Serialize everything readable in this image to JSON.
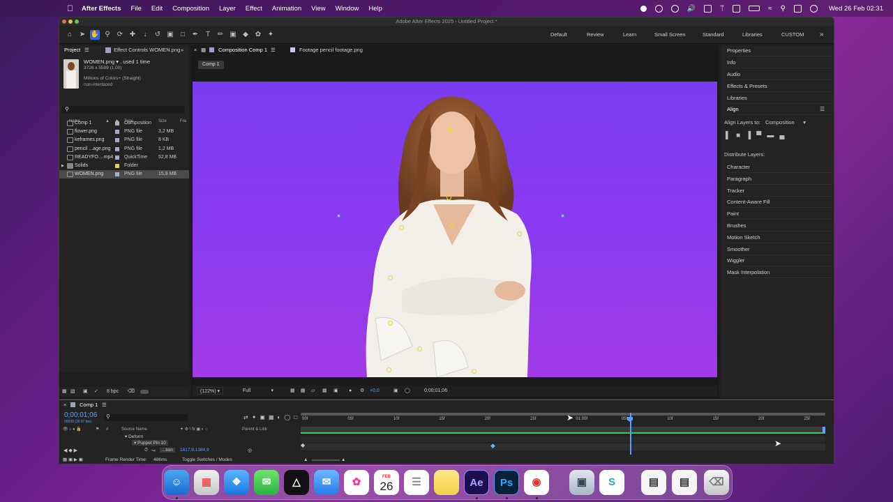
{
  "menubar": {
    "app": "After Effects",
    "items": [
      "File",
      "Edit",
      "Composition",
      "Layer",
      "Effect",
      "Animation",
      "View",
      "Window",
      "Help"
    ],
    "clock": "Wed 26 Feb  02:31"
  },
  "window": {
    "title": "Adobe After Effects 2025 - Untitled Project *"
  },
  "workspaces": [
    "Default",
    "Review",
    "Learn",
    "Small Screen",
    "Standard",
    "Libraries",
    "CUSTOM"
  ],
  "project": {
    "tabs": [
      "Project",
      "Effect Controls WOMEN.png"
    ],
    "preview": {
      "name": "WOMEN.png ▾ , used 1 time",
      "dims": "3726 x 5589 (1,00)",
      "colors": "Millions of Colors+ (Straight)",
      "interlace": "non-interlaced"
    },
    "columns": [
      "Name",
      "Type",
      "Size",
      "Fra"
    ],
    "rows": [
      {
        "name": "Comp 1",
        "type": "Composition",
        "size": "",
        "label": "#b0b0b0"
      },
      {
        "name": "flower.png",
        "type": "PNG file",
        "size": "3,2 MB",
        "label": "#a9a9c8"
      },
      {
        "name": "keframes.png",
        "type": "PNG file",
        "size": "8 KB",
        "label": "#a9a9c8"
      },
      {
        "name": "pencil ...age.png",
        "type": "PNG file",
        "size": "1,2 MB",
        "label": "#a9a9c8"
      },
      {
        "name": "READYFO....mp4",
        "type": "QuickTime",
        "size": "52,8 MB",
        "label": "#a9a9c8"
      },
      {
        "name": "Solids",
        "type": "Folder",
        "size": "",
        "label": "#e0d050"
      },
      {
        "name": "WOMEN.png",
        "type": "PNG file",
        "size": "15,9 MB",
        "label": "#a9a9c8"
      }
    ],
    "bpc": "8 bpc"
  },
  "viewer": {
    "tabs": [
      "Composition Comp 1",
      "Footage pencil footage.png"
    ],
    "comp_chip": "Comp 1",
    "zoom": "(122%)",
    "quality": "Full",
    "exposure": "+0,0",
    "timecode": "0;00;01;06"
  },
  "right_panel": {
    "items_top": [
      "Properties",
      "Info",
      "Audio",
      "Effects & Presets",
      "Libraries"
    ],
    "align_title": "Align",
    "align_to_label": "Align Layers to:",
    "align_to_value": "Composition",
    "distribute": "Distribute Layers:",
    "items_bottom": [
      "Character",
      "Paragraph",
      "Tracker",
      "Content-Aware Fill",
      "Paint",
      "Brushes",
      "Motion Sketch",
      "Smoother",
      "Wiggler",
      "Mask Interpolation"
    ]
  },
  "timeline": {
    "tab": "Comp 1",
    "timecode": "0;00;01;06",
    "subcode": "00030 (29.97 fps)",
    "col_source": "Source Name",
    "col_parent": "Parent & Link",
    "ruler": [
      "00f",
      "05f",
      "10f",
      "15f",
      "20f",
      "25f",
      "01:00f",
      "05f",
      "10f",
      "15f",
      "20f",
      "25f"
    ],
    "layer_deform": "Deform",
    "layer_pin": "Puppet Pin 10",
    "pos_label": "...tion",
    "pos_value": "1817,9,1384,9",
    "render_time_label": "Frame Render Time:",
    "render_time": "486ms",
    "toggle": "Toggle Switches / Modes"
  },
  "dock": {
    "calendar_month": "FEB",
    "calendar_day": "26",
    "ae": "Ae",
    "ps": "Ps"
  }
}
